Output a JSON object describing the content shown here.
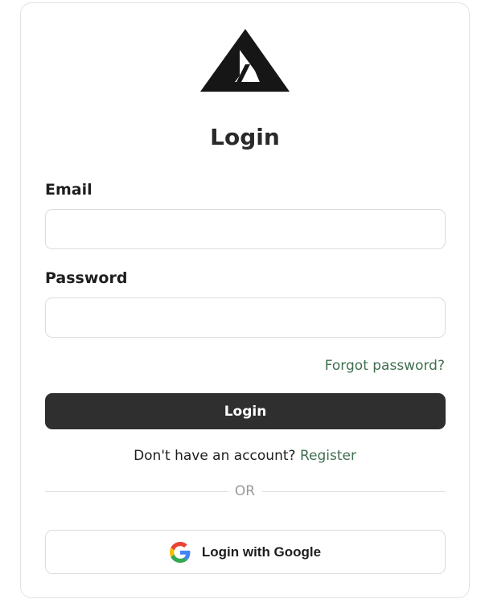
{
  "title": "Login",
  "email": {
    "label": "Email",
    "value": "",
    "placeholder": ""
  },
  "password": {
    "label": "Password",
    "value": "",
    "placeholder": ""
  },
  "forgot_password": "Forgot password?",
  "login_button": "Login",
  "register": {
    "prompt": "Don't have an account?",
    "link": "Register"
  },
  "divider": "OR",
  "google_button": "Login with Google",
  "icons": {
    "logo": "brand-logo-mountain-icon",
    "google": "google-g-icon"
  },
  "colors": {
    "primary_button": "#2f2f2f",
    "link": "#3f6e4f",
    "border": "#dcdcdc"
  }
}
